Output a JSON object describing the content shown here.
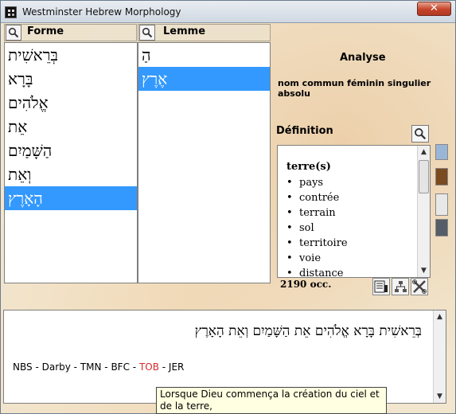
{
  "window": {
    "title": "Westminster Hebrew Morphology",
    "close_label": "✕"
  },
  "forme": {
    "header": "Forme",
    "items": [
      "בְּרֵאשִׁית",
      "בָּרָא",
      "אֱלֹהִים",
      "אֵת",
      "הַשָּׁמַיִם",
      "וְאֵת",
      "הָאָרֶץ"
    ],
    "selected_index": 6
  },
  "lemme": {
    "header": "Lemme",
    "items": [
      "הַ",
      "אֶרֶץ"
    ],
    "selected_index": 1
  },
  "analyse": {
    "title": "Analyse",
    "text": "nom commun féminin singulier absolu"
  },
  "definition": {
    "title": "Définition",
    "headword": "terre(s)",
    "senses": [
      "pays",
      "contrée",
      "terrain",
      "sol",
      "territoire",
      "voie",
      "distance"
    ],
    "occurrences": "2190 occ."
  },
  "verse": {
    "hebrew": "בְּרֵאשִׁית בָּרָא אֱלֹהִים אֵת הַשָּׁמַיִם וְאֵת הָאָרֶץ",
    "versions": [
      "NBS",
      "Darby",
      "TMN",
      "BFC",
      "TOB",
      "JER"
    ],
    "active_version": "TOB",
    "separator": " - ",
    "tooltip": "Lorsque Dieu commença la création du ciel et de la terre,"
  },
  "colors": {
    "selection": "#3399ff",
    "active_version": "#d42b2b"
  },
  "icons": {
    "search": "magnifier-icon",
    "tools": [
      "concordance-icon",
      "tree-icon",
      "tools-icon"
    ]
  }
}
